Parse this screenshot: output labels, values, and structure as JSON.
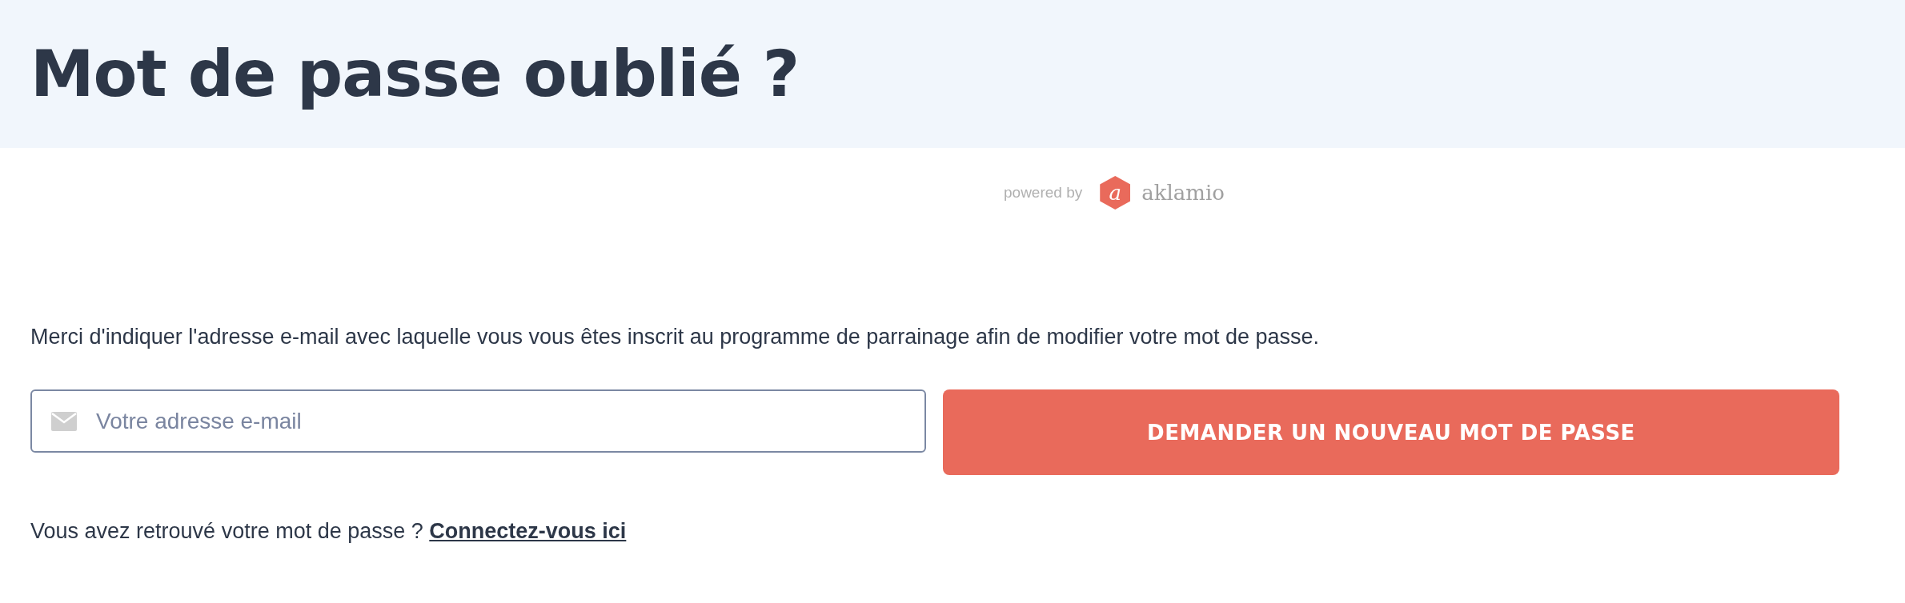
{
  "header": {
    "title": "Mot de passe oublié ?"
  },
  "branding": {
    "powered_by": "powered by",
    "logo_letter": "a",
    "logo_name": "aklamio"
  },
  "instructions": "Merci d'indiquer l'adresse e-mail avec laquelle vous vous êtes inscrit au programme de parrainage afin de modifier votre mot de passe.",
  "form": {
    "email": {
      "placeholder": "Votre adresse e-mail"
    },
    "submit": "DEMANDER UN NOUVEAU MOT DE PASSE"
  },
  "footer": {
    "text": "Vous avez retrouvé votre mot de passe ?",
    "link": "Connectez-vous ici"
  }
}
